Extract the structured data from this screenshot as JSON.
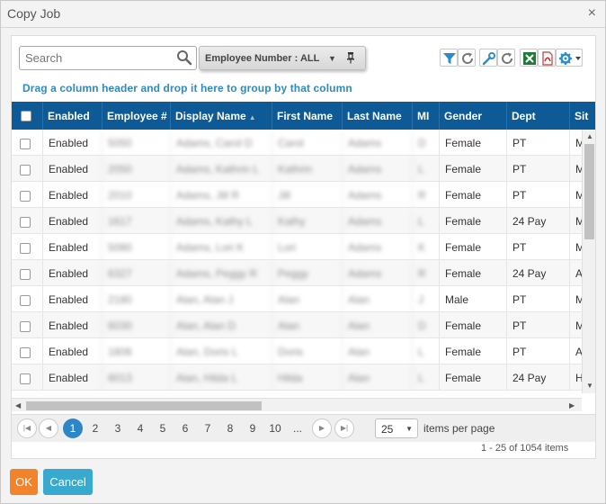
{
  "dialog": {
    "title": "Copy Job",
    "close": "×"
  },
  "search": {
    "placeholder": "Search"
  },
  "filter_chip": {
    "label": "Employee Number : ALL",
    "caret": "▼"
  },
  "group_hint": "Drag a column header and drop it here to group by that column",
  "columns": [
    {
      "key": "select",
      "label": ""
    },
    {
      "key": "enabled",
      "label": "Enabled"
    },
    {
      "key": "employee_no",
      "label": "Employee #"
    },
    {
      "key": "display_name",
      "label": "Display Name",
      "sort": "▲"
    },
    {
      "key": "first_name",
      "label": "First Name"
    },
    {
      "key": "last_name",
      "label": "Last Name"
    },
    {
      "key": "mi",
      "label": "MI"
    },
    {
      "key": "gender",
      "label": "Gender"
    },
    {
      "key": "dept",
      "label": "Dept"
    },
    {
      "key": "site",
      "label": "Sit"
    }
  ],
  "rows": [
    {
      "enabled": "Enabled",
      "employee_no": "5050",
      "display_name": "Adams, Carol D",
      "first_name": "Carol",
      "last_name": "Adams",
      "mi": "D",
      "gender": "Female",
      "dept": "PT",
      "site": "M"
    },
    {
      "enabled": "Enabled",
      "employee_no": "2050",
      "display_name": "Adams, Kathrin L",
      "first_name": "Kathrin",
      "last_name": "Adams",
      "mi": "L",
      "gender": "Female",
      "dept": "PT",
      "site": "M"
    },
    {
      "enabled": "Enabled",
      "employee_no": "2010",
      "display_name": "Adams, Jill R",
      "first_name": "Jill",
      "last_name": "Adams",
      "mi": "R",
      "gender": "Female",
      "dept": "PT",
      "site": "M"
    },
    {
      "enabled": "Enabled",
      "employee_no": "1617",
      "display_name": "Adams, Kathy L",
      "first_name": "Kathy",
      "last_name": "Adams",
      "mi": "L",
      "gender": "Female",
      "dept": "24 Pay",
      "site": "M"
    },
    {
      "enabled": "Enabled",
      "employee_no": "5080",
      "display_name": "Adams, Lori K",
      "first_name": "Lori",
      "last_name": "Adams",
      "mi": "K",
      "gender": "Female",
      "dept": "PT",
      "site": "M"
    },
    {
      "enabled": "Enabled",
      "employee_no": "6327",
      "display_name": "Adams, Peggy R",
      "first_name": "Peggy",
      "last_name": "Adams",
      "mi": "R",
      "gender": "Female",
      "dept": "24 Pay",
      "site": "A"
    },
    {
      "enabled": "Enabled",
      "employee_no": "2180",
      "display_name": "Alan, Alan J",
      "first_name": "Alan",
      "last_name": "Alan",
      "mi": "J",
      "gender": "Male",
      "dept": "PT",
      "site": "M"
    },
    {
      "enabled": "Enabled",
      "employee_no": "6030",
      "display_name": "Alan, Alan D",
      "first_name": "Alan",
      "last_name": "Alan",
      "mi": "D",
      "gender": "Female",
      "dept": "PT",
      "site": "M"
    },
    {
      "enabled": "Enabled",
      "employee_no": "1806",
      "display_name": "Alan, Doris L",
      "first_name": "Doris",
      "last_name": "Alan",
      "mi": "L",
      "gender": "Female",
      "dept": "PT",
      "site": "A"
    },
    {
      "enabled": "Enabled",
      "employee_no": "6013",
      "display_name": "Alan, Hilda L",
      "first_name": "Hilda",
      "last_name": "Alan",
      "mi": "L",
      "gender": "Female",
      "dept": "24 Pay",
      "site": "H"
    }
  ],
  "pager": {
    "pages": [
      "1",
      "2",
      "3",
      "4",
      "5",
      "6",
      "7",
      "8",
      "9",
      "10",
      "..."
    ],
    "active_page": "1",
    "per_page": "25",
    "per_page_label": "items per page",
    "info": "1 - 25 of 1054 items"
  },
  "buttons": {
    "ok": "OK",
    "cancel": "Cancel"
  },
  "colors": {
    "header_bg": "#0e5a96",
    "hint_text": "#2e8bc0",
    "ok_bg": "#f0832c",
    "cancel_bg": "#3aa9d0",
    "active_page": "#2d86c5"
  }
}
